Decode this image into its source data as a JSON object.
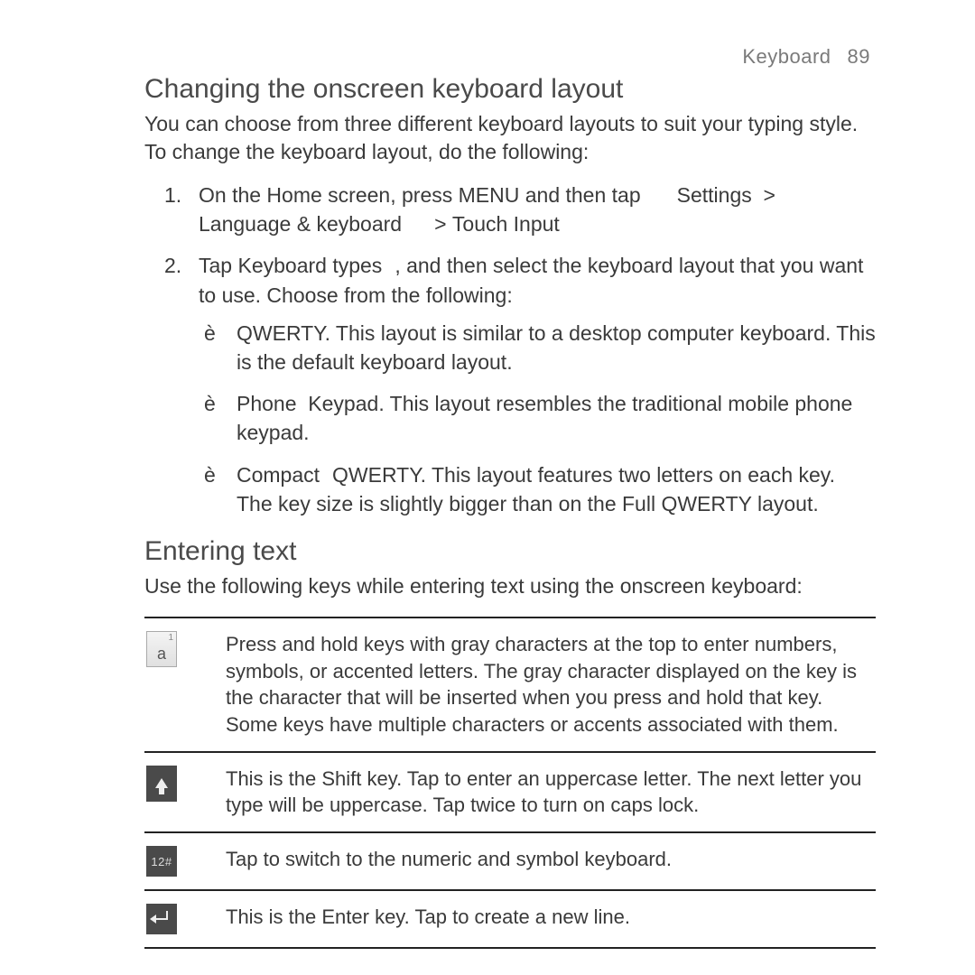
{
  "header": {
    "section": "Keyboard",
    "page": "89"
  },
  "s1": {
    "title": "Changing the onscreen keyboard layout",
    "intro": "You can choose from three different keyboard layouts to suit your typing style. To change the keyboard layout, do the following:",
    "step1": {
      "num": "1.",
      "a": "On the Home screen, press MENU and then tap",
      "settings": "Settings",
      "gt1": ">",
      "lang": "Language & keyboard",
      "gt2": ">",
      "touch": "Touch Input"
    },
    "step2": {
      "num": "2.",
      "a": "Tap",
      "types": "Keyboard types",
      "b": ", and then select the keyboard layout that you want to use. Choose from the following:"
    },
    "bullets": {
      "marker": "è",
      "b1": {
        "name": "QWERTY",
        "text": ". This layout is similar to a desktop computer keyboard. This is the default keyboard layout."
      },
      "b2": {
        "name": "Phone",
        "name2": "Keypad",
        "text": ". This layout resembles the traditional mobile phone keypad."
      },
      "b3": {
        "name": "Compact",
        "name2": "QWERTY",
        "text": ". This layout features two letters on each key. The key size is slightly bigger than on the Full QWERTY layout."
      }
    }
  },
  "s2": {
    "title": "Entering text",
    "intro": "Use the following keys while entering text using the onscreen keyboard:"
  },
  "keys": {
    "r1": {
      "iconTop": "1",
      "iconMain": "a",
      "desc": "Press and hold keys with gray characters at the top to enter numbers, symbols, or accented letters. The gray character displayed on the key is the character that will be inserted when you press and hold that key. Some keys have multiple characters or accents associated with them."
    },
    "r2": {
      "desc": "This is the Shift key. Tap to enter an uppercase letter. The next letter you type will be uppercase. Tap twice to turn on caps lock."
    },
    "r3": {
      "label": "12#",
      "desc": "Tap to switch to the numeric and symbol keyboard."
    },
    "r4": {
      "desc": "This is the Enter key. Tap to create a new line."
    }
  }
}
